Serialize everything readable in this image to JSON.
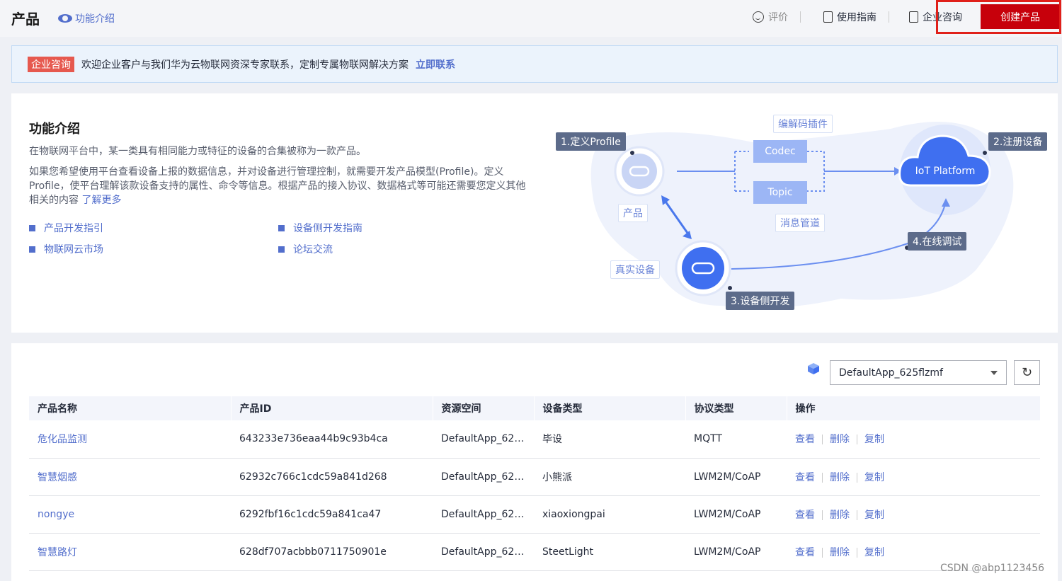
{
  "header": {
    "title": "产品",
    "intro_link": "功能介绍",
    "tools": [
      {
        "label": "评价",
        "icon": "smile-icon"
      },
      {
        "label": "使用指南",
        "icon": "guide-icon"
      },
      {
        "label": "企业咨询",
        "icon": "consult-icon"
      }
    ],
    "create_button": "创建产品"
  },
  "banner": {
    "tag": "企业咨询",
    "text": "欢迎企业客户与我们华为云物联网资深专家联系，定制专属物联网解决方案",
    "link": "立即联系"
  },
  "intro": {
    "title": "功能介绍",
    "p1": "在物联网平台中，某一类具有相同能力或特征的设备的合集被称为一款产品。",
    "p2": "如果您希望使用平台查看设备上报的数据信息，并对设备进行管理控制，就需要开发产品模型(Profile)。定义Profile，使平台理解该款设备支持的属性、命令等信息。根据产品的接入协议、数据格式等可能还需要您定义其他相关的内容",
    "more": "了解更多",
    "links": [
      "产品开发指引",
      "设备侧开发指南",
      "物联网云市场",
      "论坛交流"
    ]
  },
  "diagram": {
    "step1": "1.定义Profile",
    "step2": "2.注册设备",
    "step3": "3.设备侧开发",
    "step4": "4.在线调试",
    "product": "产品",
    "real_device": "真实设备",
    "codec_plugin": "编解码插件",
    "codec": "Codec",
    "topic": "Topic",
    "msg_channel": "消息管道",
    "platform": "IoT Platform"
  },
  "table": {
    "app_select": "DefaultApp_625flzmf",
    "columns": [
      "产品名称",
      "产品ID",
      "资源空间",
      "设备类型",
      "协议类型",
      "操作"
    ],
    "ops": [
      "查看",
      "删除",
      "复制"
    ],
    "rows": [
      {
        "name": "危化品监测",
        "id": "643233e736eaa44b9c93b4ca",
        "space": "DefaultApp_62…",
        "type": "毕设",
        "protocol": "MQTT"
      },
      {
        "name": "智慧烟感",
        "id": "62932c766c1cdc59a841d268",
        "space": "DefaultApp_62…",
        "type": "小熊派",
        "protocol": "LWM2M/CoAP"
      },
      {
        "name": "nongye",
        "id": "6292fbf16c1cdc59a841ca47",
        "space": "DefaultApp_62…",
        "type": "xiaoxiongpai",
        "protocol": "LWM2M/CoAP"
      },
      {
        "name": "智慧路灯",
        "id": "628df707acbbb0711750901e",
        "space": "DefaultApp_62…",
        "type": "SteetLight",
        "protocol": "LWM2M/CoAP"
      }
    ]
  },
  "watermark": "CSDN @abp1123456"
}
